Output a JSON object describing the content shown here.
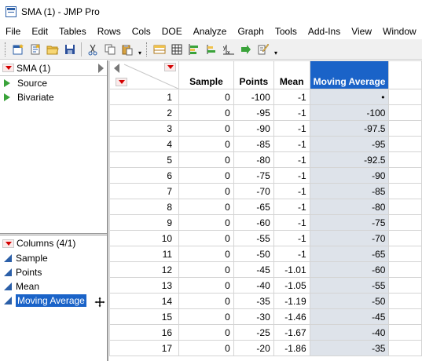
{
  "window": {
    "title": "SMA (1) - JMP Pro"
  },
  "menu": [
    "File",
    "Edit",
    "Tables",
    "Rows",
    "Cols",
    "DOE",
    "Analyze",
    "Graph",
    "Tools",
    "Add-Ins",
    "View",
    "Window",
    "H"
  ],
  "table_panel": {
    "title": "SMA (1)",
    "scripts": [
      "Source",
      "Bivariate"
    ]
  },
  "columns_panel": {
    "title": "Columns (4/1)",
    "columns": [
      "Sample",
      "Points",
      "Mean",
      "Moving Average"
    ],
    "selected": "Moving Average"
  },
  "grid": {
    "headers": [
      "Sample",
      "Points",
      "Mean",
      "Moving Average"
    ],
    "rows": [
      [
        "1",
        "0",
        "-100",
        "-1",
        "•"
      ],
      [
        "2",
        "0",
        "-95",
        "-1",
        "-100"
      ],
      [
        "3",
        "0",
        "-90",
        "-1",
        "-97.5"
      ],
      [
        "4",
        "0",
        "-85",
        "-1",
        "-95"
      ],
      [
        "5",
        "0",
        "-80",
        "-1",
        "-92.5"
      ],
      [
        "6",
        "0",
        "-75",
        "-1",
        "-90"
      ],
      [
        "7",
        "0",
        "-70",
        "-1",
        "-85"
      ],
      [
        "8",
        "0",
        "-65",
        "-1",
        "-80"
      ],
      [
        "9",
        "0",
        "-60",
        "-1",
        "-75"
      ],
      [
        "10",
        "0",
        "-55",
        "-1",
        "-70"
      ],
      [
        "11",
        "0",
        "-50",
        "-1",
        "-65"
      ],
      [
        "12",
        "0",
        "-45",
        "-1.01",
        "-60"
      ],
      [
        "13",
        "0",
        "-40",
        "-1.05",
        "-55"
      ],
      [
        "14",
        "0",
        "-35",
        "-1.19",
        "-50"
      ],
      [
        "15",
        "0",
        "-30",
        "-1.46",
        "-45"
      ],
      [
        "16",
        "0",
        "-25",
        "-1.67",
        "-40"
      ],
      [
        "17",
        "0",
        "-20",
        "-1.86",
        "-35"
      ]
    ]
  },
  "colors": {
    "selection": "#1a63c8",
    "selected_column_bg": "#dee3ea",
    "red_triangle": "#d40000",
    "green_triangle": "#3aa33a"
  }
}
